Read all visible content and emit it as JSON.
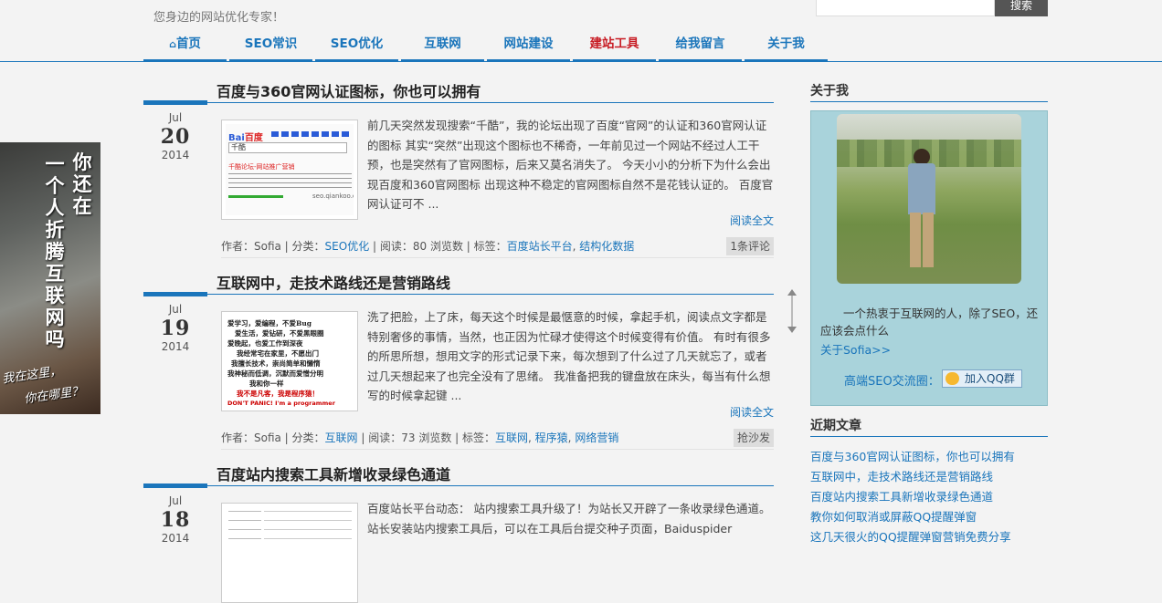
{
  "header": {
    "slogan": "您身边的网站优化专家！",
    "search_button": "搜索"
  },
  "nav": [
    {
      "label": "首页",
      "icon": "home-icon"
    },
    {
      "label": "SEO常识"
    },
    {
      "label": "SEO优化"
    },
    {
      "label": "互联网"
    },
    {
      "label": "网站建设"
    },
    {
      "label": "建站工具",
      "highlight": "#c81d25"
    },
    {
      "label": "给我留言"
    },
    {
      "label": "关于我"
    }
  ],
  "posts": [
    {
      "title": "百度与360官网认证图标，你也可以拥有",
      "month": "Jul",
      "day": "20",
      "year": "2014",
      "excerpt": "前几天突然发现搜索“千酷”，我的论坛出现了百度“官网”的认证和360官网认证的图标 其实“突然”出现这个图标也不稀奇，一年前见过一个网站不经过人工干预，也是突然有了官网图标，后来又莫名消失了。 今天小小的分析下为什么会出现百度和360官网图标 出现这种不稳定的官网图标自然不是花钱认证的。 百度官网认证可不 ...",
      "read_more": "阅读全文",
      "meta_author": "作者：Sofia | 分类：",
      "category": "SEO优化",
      "meta_views": " | 阅读：80 浏览数 | 标签：",
      "tags": [
        "百度站长平台",
        "结构化数据"
      ],
      "comments": "1条评论",
      "thumb_text": [
        "Bai",
        "百度",
        "千酷",
        "千酷论坛-网站推广营销",
        "seo.qiankoo.com"
      ]
    },
    {
      "title": "互联网中，走技术路线还是营销路线",
      "month": "Jul",
      "day": "19",
      "year": "2014",
      "excerpt": "洗了把脸，上了床，每天这个时候是最惬意的时候，拿起手机，阅读点文字都是特别奢侈的事情，当然，也正因为忙碌才使得这个时候变得有价值。 有时有很多的所思所想，想用文字的形式记录下来，每次想到了什么过了几天就忘了，或者过几天想起来了也完全没有了思绪。 我准备把我的键盘放在床头，每当有什么想写的时候拿起键 ...",
      "read_more": "阅读全文",
      "meta_author": "作者：Sofia | 分类：",
      "category": "互联网",
      "meta_views": " | 阅读：73 浏览数 | 标签：",
      "tags": [
        "互联网",
        "程序猿",
        "网络营销"
      ],
      "comments": "抢沙发",
      "thumb_text": [
        "爱学习，爱编程，不爱Bug",
        "爱生活，爱钻研，不爱黑眼圈",
        "爱晚起，也爱工作到深夜",
        "我经常宅在家里，不愿出门",
        "我擅长技术，崇尚简单和懒惰",
        "我神秘而低调，沉默而爱憎分明",
        "我和你一样",
        "我不是凡客，我是程序猿！",
        "DON'T PANIC!  I'm a programmer"
      ]
    },
    {
      "title": "百度站内搜索工具新增收录绿色通道",
      "month": "Jul",
      "day": "18",
      "year": "2014",
      "excerpt": "百度站长平台动态： 站内搜索工具升级了！为站长又开辟了一条收录绿色通道。站长安装站内搜索工具后，可以在工具后台提交种子页面，Baiduspider"
    }
  ],
  "sidebar": {
    "about_title": "关于我",
    "about_text": "一个热衷于互联网的人，除了SEO，还应该会点什么",
    "about_link": "关于Sofia>>",
    "qq_label": "高端SEO交流圈：",
    "qq_button": "加入QQ群",
    "recent_title": "近期文章",
    "recent": [
      "百度与360官网认证图标，你也可以拥有",
      "互联网中，走技术路线还是营销路线",
      "百度站内搜索工具新增收录绿色通道",
      "教你如何取消或屏蔽QQ提醒弹窗",
      "这几天很火的QQ提醒弹窗营销免费分享"
    ]
  },
  "left_ad": {
    "col1": "你还在",
    "col2": "一个人折腾互联网吗",
    "hand1": "我在这里，",
    "hand2": "你在哪里？"
  },
  "colors": {
    "accent": "#1a75bb",
    "highlight": "#c81d25"
  }
}
